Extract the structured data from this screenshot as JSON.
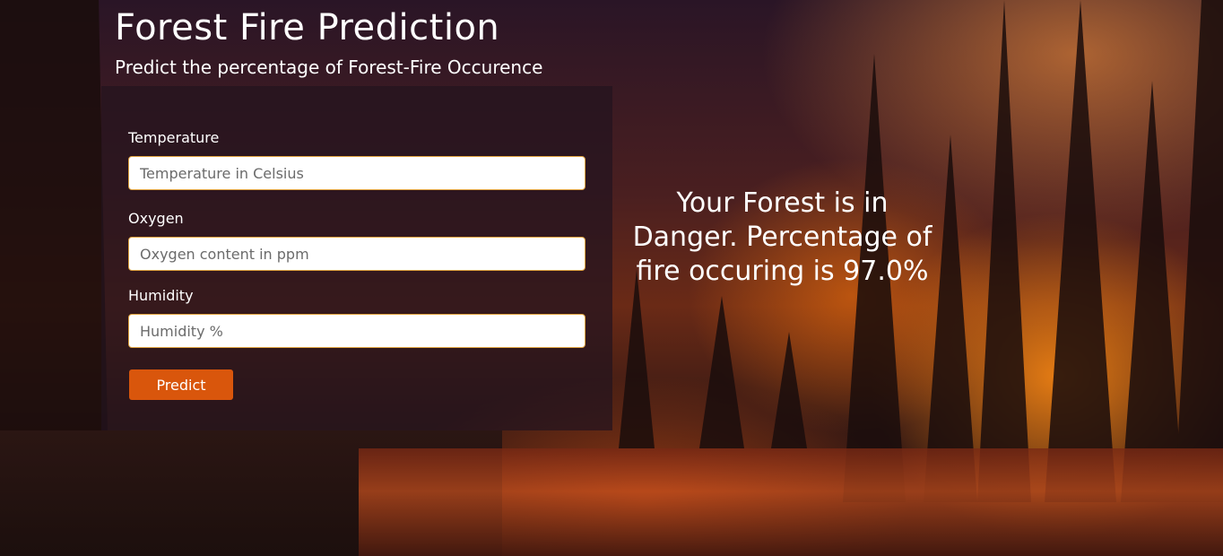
{
  "header": {
    "title": "Forest Fire Prediction",
    "subtitle": "Predict the percentage of Forest-Fire Occurence"
  },
  "form": {
    "fields": [
      {
        "label": "Temperature",
        "placeholder": "Temperature in Celsius",
        "value": ""
      },
      {
        "label": "Oxygen",
        "placeholder": "Oxygen content in ppm",
        "value": ""
      },
      {
        "label": "Humidity",
        "placeholder": "Humidity %",
        "value": ""
      }
    ],
    "submit_label": "Predict",
    "accent_color": "#d9560c"
  },
  "result": {
    "text": "Your Forest is in Danger. Percentage of fire occuring is 97.0%",
    "probability": 97.0
  }
}
